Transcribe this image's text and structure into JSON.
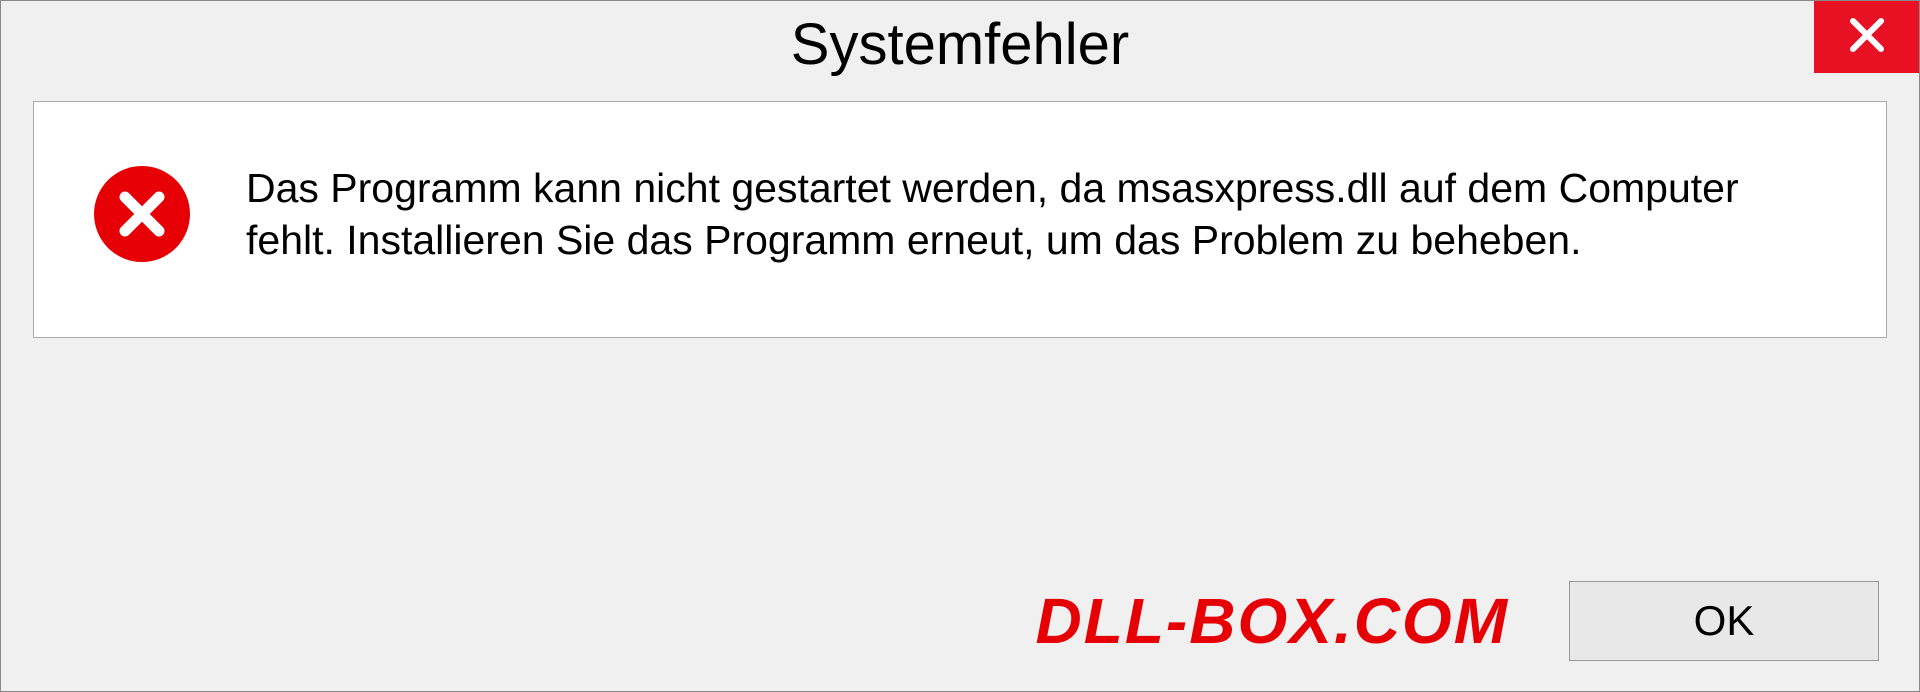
{
  "dialog": {
    "title": "Systemfehler",
    "message": "Das Programm kann nicht gestartet werden, da msasxpress.dll auf dem Computer fehlt. Installieren Sie das Programm erneut, um das Problem zu beheben.",
    "ok_label": "OK"
  },
  "watermark": "DLL-BOX.COM",
  "colors": {
    "close_red": "#e81123",
    "error_red": "#e60005",
    "dialog_bg": "#f0f0f0",
    "content_bg": "#ffffff"
  }
}
